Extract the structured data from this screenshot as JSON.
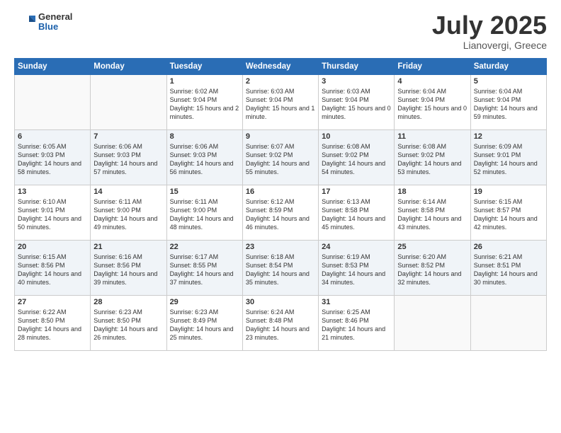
{
  "header": {
    "logo_general": "General",
    "logo_blue": "Blue",
    "month": "July 2025",
    "location": "Lianovergi, Greece"
  },
  "weekdays": [
    "Sunday",
    "Monday",
    "Tuesday",
    "Wednesday",
    "Thursday",
    "Friday",
    "Saturday"
  ],
  "weeks": [
    [
      {
        "day": "",
        "content": ""
      },
      {
        "day": "",
        "content": ""
      },
      {
        "day": "1",
        "content": "Sunrise: 6:02 AM\nSunset: 9:04 PM\nDaylight: 15 hours and 2 minutes."
      },
      {
        "day": "2",
        "content": "Sunrise: 6:03 AM\nSunset: 9:04 PM\nDaylight: 15 hours and 1 minute."
      },
      {
        "day": "3",
        "content": "Sunrise: 6:03 AM\nSunset: 9:04 PM\nDaylight: 15 hours and 0 minutes."
      },
      {
        "day": "4",
        "content": "Sunrise: 6:04 AM\nSunset: 9:04 PM\nDaylight: 15 hours and 0 minutes."
      },
      {
        "day": "5",
        "content": "Sunrise: 6:04 AM\nSunset: 9:04 PM\nDaylight: 14 hours and 59 minutes."
      }
    ],
    [
      {
        "day": "6",
        "content": "Sunrise: 6:05 AM\nSunset: 9:03 PM\nDaylight: 14 hours and 58 minutes."
      },
      {
        "day": "7",
        "content": "Sunrise: 6:06 AM\nSunset: 9:03 PM\nDaylight: 14 hours and 57 minutes."
      },
      {
        "day": "8",
        "content": "Sunrise: 6:06 AM\nSunset: 9:03 PM\nDaylight: 14 hours and 56 minutes."
      },
      {
        "day": "9",
        "content": "Sunrise: 6:07 AM\nSunset: 9:02 PM\nDaylight: 14 hours and 55 minutes."
      },
      {
        "day": "10",
        "content": "Sunrise: 6:08 AM\nSunset: 9:02 PM\nDaylight: 14 hours and 54 minutes."
      },
      {
        "day": "11",
        "content": "Sunrise: 6:08 AM\nSunset: 9:02 PM\nDaylight: 14 hours and 53 minutes."
      },
      {
        "day": "12",
        "content": "Sunrise: 6:09 AM\nSunset: 9:01 PM\nDaylight: 14 hours and 52 minutes."
      }
    ],
    [
      {
        "day": "13",
        "content": "Sunrise: 6:10 AM\nSunset: 9:01 PM\nDaylight: 14 hours and 50 minutes."
      },
      {
        "day": "14",
        "content": "Sunrise: 6:11 AM\nSunset: 9:00 PM\nDaylight: 14 hours and 49 minutes."
      },
      {
        "day": "15",
        "content": "Sunrise: 6:11 AM\nSunset: 9:00 PM\nDaylight: 14 hours and 48 minutes."
      },
      {
        "day": "16",
        "content": "Sunrise: 6:12 AM\nSunset: 8:59 PM\nDaylight: 14 hours and 46 minutes."
      },
      {
        "day": "17",
        "content": "Sunrise: 6:13 AM\nSunset: 8:58 PM\nDaylight: 14 hours and 45 minutes."
      },
      {
        "day": "18",
        "content": "Sunrise: 6:14 AM\nSunset: 8:58 PM\nDaylight: 14 hours and 43 minutes."
      },
      {
        "day": "19",
        "content": "Sunrise: 6:15 AM\nSunset: 8:57 PM\nDaylight: 14 hours and 42 minutes."
      }
    ],
    [
      {
        "day": "20",
        "content": "Sunrise: 6:15 AM\nSunset: 8:56 PM\nDaylight: 14 hours and 40 minutes."
      },
      {
        "day": "21",
        "content": "Sunrise: 6:16 AM\nSunset: 8:56 PM\nDaylight: 14 hours and 39 minutes."
      },
      {
        "day": "22",
        "content": "Sunrise: 6:17 AM\nSunset: 8:55 PM\nDaylight: 14 hours and 37 minutes."
      },
      {
        "day": "23",
        "content": "Sunrise: 6:18 AM\nSunset: 8:54 PM\nDaylight: 14 hours and 35 minutes."
      },
      {
        "day": "24",
        "content": "Sunrise: 6:19 AM\nSunset: 8:53 PM\nDaylight: 14 hours and 34 minutes."
      },
      {
        "day": "25",
        "content": "Sunrise: 6:20 AM\nSunset: 8:52 PM\nDaylight: 14 hours and 32 minutes."
      },
      {
        "day": "26",
        "content": "Sunrise: 6:21 AM\nSunset: 8:51 PM\nDaylight: 14 hours and 30 minutes."
      }
    ],
    [
      {
        "day": "27",
        "content": "Sunrise: 6:22 AM\nSunset: 8:50 PM\nDaylight: 14 hours and 28 minutes."
      },
      {
        "day": "28",
        "content": "Sunrise: 6:23 AM\nSunset: 8:50 PM\nDaylight: 14 hours and 26 minutes."
      },
      {
        "day": "29",
        "content": "Sunrise: 6:23 AM\nSunset: 8:49 PM\nDaylight: 14 hours and 25 minutes."
      },
      {
        "day": "30",
        "content": "Sunrise: 6:24 AM\nSunset: 8:48 PM\nDaylight: 14 hours and 23 minutes."
      },
      {
        "day": "31",
        "content": "Sunrise: 6:25 AM\nSunset: 8:46 PM\nDaylight: 14 hours and 21 minutes."
      },
      {
        "day": "",
        "content": ""
      },
      {
        "day": "",
        "content": ""
      }
    ]
  ]
}
